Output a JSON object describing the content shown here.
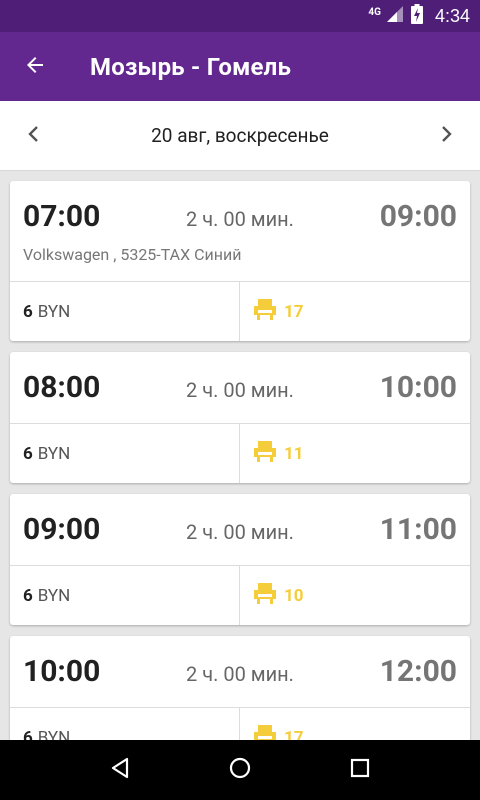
{
  "status": {
    "network": "4G",
    "time": "4:34"
  },
  "app_bar": {
    "title": "Мозырь - Гомель"
  },
  "date_bar": {
    "date": "20 авг, воскресенье"
  },
  "trips": [
    {
      "departure": "07:00",
      "duration": "2 ч. 00 мин.",
      "arrival": "09:00",
      "vehicle": "Volkswagen , 5325-TAX Синий",
      "price_value": "6",
      "price_currency": "BYN",
      "seats": "17"
    },
    {
      "departure": "08:00",
      "duration": "2 ч. 00 мин.",
      "arrival": "10:00",
      "vehicle": "",
      "price_value": "6",
      "price_currency": "BYN",
      "seats": "11"
    },
    {
      "departure": "09:00",
      "duration": "2 ч. 00 мин.",
      "arrival": "11:00",
      "vehicle": "",
      "price_value": "6",
      "price_currency": "BYN",
      "seats": "10"
    },
    {
      "departure": "10:00",
      "duration": "2 ч. 00 мин.",
      "arrival": "12:00",
      "vehicle": "",
      "price_value": "6",
      "price_currency": "BYN",
      "seats": "17"
    }
  ],
  "colors": {
    "status_bar": "#4f1f78",
    "app_bar": "#62288f",
    "seat_accent": "#f5cd3a"
  },
  "icons": {
    "back": "arrow-left-icon",
    "prev": "chevron-left-icon",
    "next": "chevron-right-icon",
    "seat": "seat-icon",
    "nav_back": "triangle-back-icon",
    "nav_home": "circle-home-icon",
    "nav_recent": "square-recent-icon"
  }
}
